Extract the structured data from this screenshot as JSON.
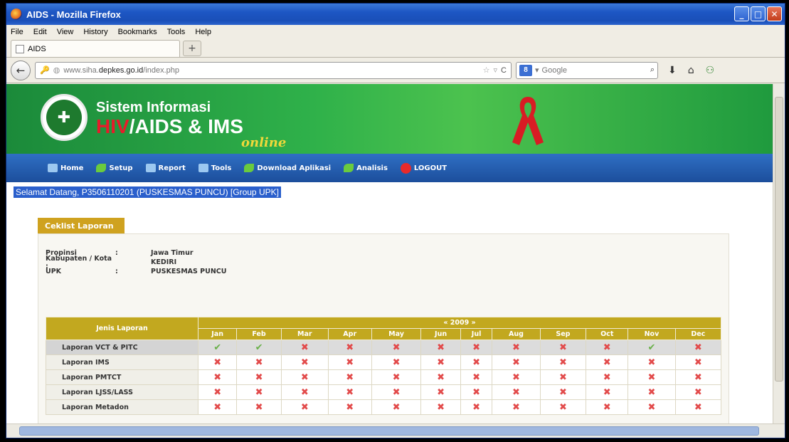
{
  "window": {
    "title": "AIDS - Mozilla Firefox"
  },
  "menu": [
    "File",
    "Edit",
    "View",
    "History",
    "Bookmarks",
    "Tools",
    "Help"
  ],
  "tab": {
    "label": "AIDS",
    "new_tab": "+"
  },
  "address": {
    "prefix": "www.siha.",
    "domain": "depkes.go.id",
    "path": "/index.php"
  },
  "search": {
    "engine": "8",
    "placeholder": "Google"
  },
  "banner": {
    "line1": "Sistem Informasi",
    "hiv": "HIV",
    "line2_rest": "/AIDS & IMS",
    "online": "online"
  },
  "nav": {
    "home": "Home",
    "setup": "Setup",
    "report": "Report",
    "tools": "Tools",
    "download": "Download Aplikasi",
    "analisis": "Analisis",
    "logout": "LOGOUT"
  },
  "welcome": "Selamat Datang, P3506110201 (PUSKESMAS PUNCU) [Group UPK]",
  "panel": {
    "tab": "Ceklist Laporan"
  },
  "info": [
    {
      "label": "Propinsi",
      "sep": ":",
      "value": "Jawa Timur"
    },
    {
      "label": "Kabupaten / Kota :",
      "sep": "",
      "value": "KEDIRI"
    },
    {
      "label": "UPK",
      "sep": ":",
      "value": "PUSKESMAS PUNCU"
    }
  ],
  "table": {
    "title": "Jenis Laporan",
    "year": "« 2009 »",
    "months": [
      "Jan",
      "Feb",
      "Mar",
      "Apr",
      "May",
      "Jun",
      "Jul",
      "Aug",
      "Sep",
      "Oct",
      "Nov",
      "Dec"
    ],
    "rows": [
      {
        "name": "Laporan VCT & PITC",
        "status": [
          1,
          1,
          0,
          0,
          0,
          0,
          0,
          0,
          0,
          0,
          1,
          0
        ]
      },
      {
        "name": "Laporan IMS",
        "status": [
          0,
          0,
          0,
          0,
          0,
          0,
          0,
          0,
          0,
          0,
          0,
          0
        ]
      },
      {
        "name": "Laporan PMTCT",
        "status": [
          0,
          0,
          0,
          0,
          0,
          0,
          0,
          0,
          0,
          0,
          0,
          0
        ]
      },
      {
        "name": "Laporan LJSS/LASS",
        "status": [
          0,
          0,
          0,
          0,
          0,
          0,
          0,
          0,
          0,
          0,
          0,
          0
        ]
      },
      {
        "name": "Laporan Metadon",
        "status": [
          0,
          0,
          0,
          0,
          0,
          0,
          0,
          0,
          0,
          0,
          0,
          0
        ]
      }
    ]
  },
  "colors": {
    "gold": "#c2a81f",
    "nav_blue": "#1c4e9c",
    "banner_green": "#2fb14a"
  }
}
